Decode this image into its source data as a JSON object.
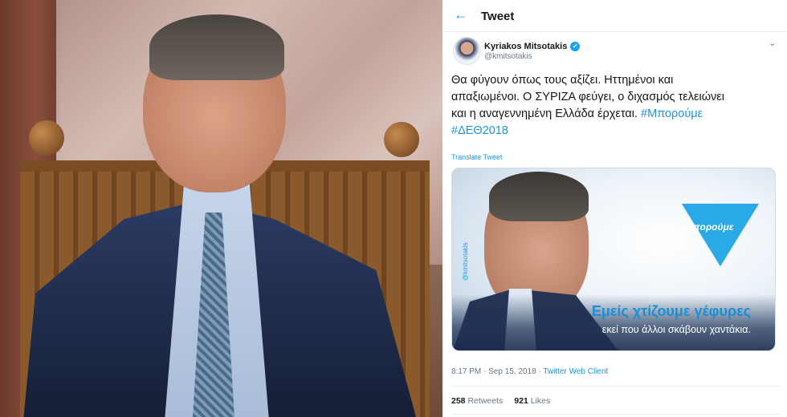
{
  "header": {
    "back_icon": "←",
    "title": "Tweet"
  },
  "author": {
    "name": "Kyriakos Mitsotakis",
    "handle": "@kmitsotakis",
    "verified_icon": "✓",
    "menu_icon": "⌄"
  },
  "tweet": {
    "text_line1": "Θα φύγουν όπως τους αξίζει. Ηττημένοι και",
    "text_line2": "απαξιωμένοι. Ο ΣΥΡΙΖΑ φεύγει, ο διχασμός τελειώνει",
    "text_line3": "και η αναγεννημένη Ελλάδα έρχεται. ",
    "hashtag1": "#Μπορούμε",
    "hashtag2": "#ΔΕΘ2018",
    "translate_label": "Translate Tweet"
  },
  "media": {
    "vertical_handle": "@kmitsotakis",
    "logo_text": "Μπορούμε",
    "slogan_main": "Εμείς χτίζουμε γέφυρες",
    "slogan_sub": "εκεί που άλλοι σκάβουν χαντάκια."
  },
  "meta": {
    "time_date": "8:17 PM · Sep 15, 2018 · ",
    "client": "Twitter Web Client"
  },
  "stats": {
    "retweets_count": "258",
    "retweets_label": "Retweets",
    "likes_count": "921",
    "likes_label": "Likes"
  },
  "colors": {
    "accent": "#1da1f2",
    "link": "#1b95e0",
    "text": "#14171a",
    "muted": "#657786"
  }
}
